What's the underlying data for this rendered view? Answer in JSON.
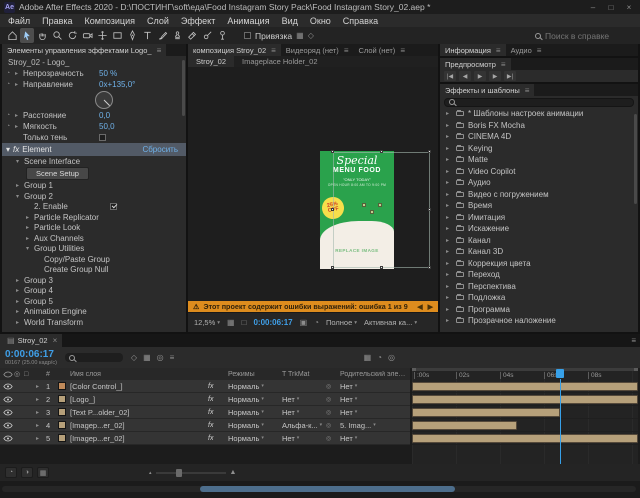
{
  "icons": {
    "menu": "≡",
    "chevron": "▾",
    "twirl_open": "▾",
    "twirl_closed": "▸",
    "arrow_left": "◀",
    "arrow_right": "▶",
    "warning": "⚠",
    "stopwatch": "◔",
    "fx": "fx",
    "pickwhip": "◎",
    "close": "×",
    "minimize": "–",
    "maximize": "□",
    "panel": "▤",
    "grid": "▦",
    "diamond": "◇",
    "circle": "◎",
    "square": "▣",
    "half": "◑",
    "quarter": "◔",
    "lock": "□",
    "hash": "#"
  },
  "titlebar": {
    "app": "Ae",
    "title": "Adobe After Effects 2020 - D:\\ПОСТИНГ\\soft\\еда\\Food Instagram Story Pack\\Food Instagram Story_02.aep *"
  },
  "menubar": {
    "items": [
      "Файл",
      "Правка",
      "Композиция",
      "Слой",
      "Эффект",
      "Анимация",
      "Вид",
      "Окно",
      "Справка"
    ]
  },
  "toolbar": {
    "snap_label": "Привязка",
    "help_search_placeholder": "Поиск в справке"
  },
  "effect_controls": {
    "tab_title": "Элементы управления эффектами Logo_",
    "target": "Stroy_02 - Logo_",
    "opacity_label": "Непрозрачность",
    "opacity_value": "50 %",
    "direction_label": "Направление",
    "direction_value": "0x+135,0°",
    "distance_label": "Расстояние",
    "distance_value": "0,0",
    "softness_label": "Мягкость",
    "softness_value": "50,0",
    "shadow_only_label": "Только тень",
    "element_fx": "fx",
    "element_label": "Element",
    "element_reset": "Сбросить",
    "scene_interface": "Scene Interface",
    "scene_setup": "Scene Setup",
    "group1": "Group 1",
    "group2": "Group 2",
    "enable": "2. Enable",
    "particle_replicator": "Particle Replicator",
    "particle_look": "Particle Look",
    "aux_channels": "Aux Channels",
    "group_utilities": "Group Utilities",
    "copy_paste": "Copy/Paste Group",
    "create_null": "Create Group Null",
    "group3": "Group 3",
    "group4": "Group 4",
    "group5": "Group 5",
    "animation_engine": "Animation Engine",
    "world_transform": "World Transform"
  },
  "composition": {
    "panel_tab": "композиция Stroy_02",
    "footage_tab": "Видеоряд  (нет)",
    "layer_tab": "Слой (нет)",
    "viewer_tab_active": "Stroy_02",
    "viewer_tab_other": "Imageplace Holder_02",
    "poster": {
      "title": "Special",
      "line2": "MENU FOOD",
      "line3": "\"ONLY TODAY\"",
      "line4": "OPEN HOUR 8:00 AM TO 9:00 PM",
      "badge_top": "25%",
      "badge_bottom": "OFF",
      "replace_label": "REPLACE IMAGE"
    },
    "warning_text": "Этот проект содержит ошибки выражений: ошибка 1 из 9",
    "status": {
      "zoom": "12,5%",
      "timecode": "0:00:06:17",
      "resolution": "Полное",
      "camera": "Активная ка..."
    }
  },
  "right_panels": {
    "info_tab": "Информация",
    "audio_tab": "Аудио",
    "preview_tab": "Предпросмотр",
    "transport": [
      "|◀",
      "◀",
      "▶",
      "▶",
      "▶|"
    ],
    "effects_tab": "Эффекты и шаблоны",
    "effects_items": [
      "* Шаблоны настроек анимации",
      "Boris FX Mocha",
      "CINEMA 4D",
      "Keying",
      "Matte",
      "Video Copilot",
      "Аудио",
      "Видео с погружением",
      "Время",
      "Имитация",
      "Искажение",
      "Канал",
      "Канал 3D",
      "Коррекция цвета",
      "Переход",
      "Перспектива",
      "Подложка",
      "Программа",
      "Прозрачное наложение"
    ]
  },
  "timeline": {
    "tab": "Stroy_02",
    "timecode": "0:00:06:17",
    "frame_info": "00167 (25.00 кадр/с)",
    "left_icons": [
      "◇",
      "▦",
      "◎",
      "≡"
    ],
    "right_icons": [
      "▦",
      "◔",
      "◎"
    ],
    "bottom_icons": [
      "◔",
      "◑",
      "▦"
    ],
    "columns": {
      "hash": "#",
      "name": "Имя слоя",
      "modes": "Режимы",
      "trkmat": "T TrkMat",
      "parent": "Родительский элемент"
    },
    "layers": [
      {
        "num": "1",
        "name": "[Color Control_]",
        "mode": "Нормаль",
        "trkmat": "",
        "parent": "Нет"
      },
      {
        "num": "2",
        "name": "[Logo_]",
        "mode": "Нормаль",
        "trkmat": "Нет",
        "parent": "Нет"
      },
      {
        "num": "3",
        "name": "[Text P...older_02]",
        "mode": "Нормаль",
        "trkmat": "Нет",
        "parent": "Нет"
      },
      {
        "num": "4",
        "name": "[Imagep...er_02]",
        "mode": "Нормаль",
        "trkmat": "Альфа-к...",
        "parent": "5. Imag..."
      },
      {
        "num": "5",
        "name": "[Imagep...er_02]",
        "mode": "Нормаль",
        "trkmat": "Нет",
        "parent": "Нет"
      }
    ],
    "ruler": [
      ":00s",
      "02s",
      "04s",
      "06s",
      "08s"
    ]
  }
}
